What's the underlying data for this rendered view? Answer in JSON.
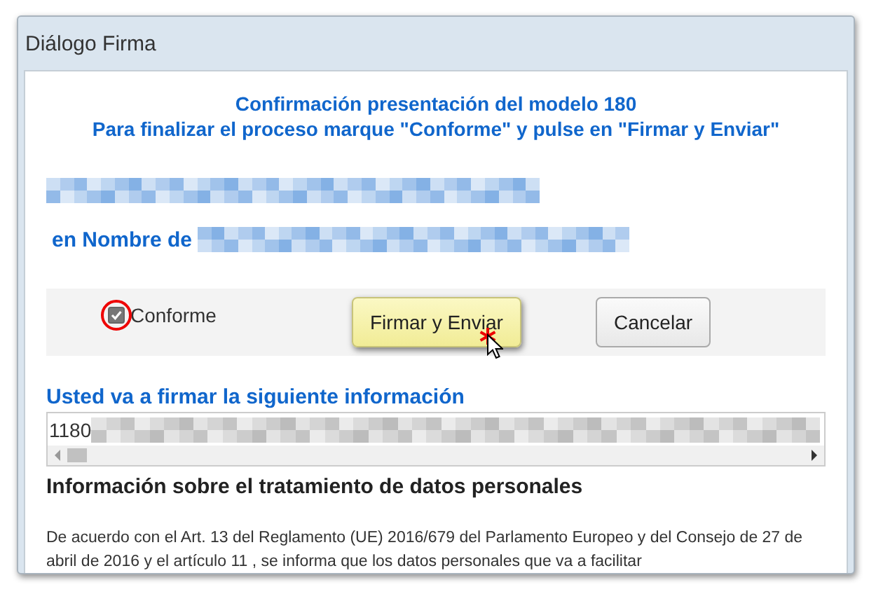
{
  "window": {
    "title": "Diálogo Firma"
  },
  "heading": [
    "Confirmación presentación del modelo 180",
    "Para finalizar el proceso marque \"Conforme\" y pulse en \"Firmar y Enviar\""
  ],
  "signer": {
    "redacted": true
  },
  "on_behalf": {
    "label": "en Nombre de",
    "redacted": true
  },
  "agree": {
    "label": "Conforme",
    "checked": true,
    "highlighted": true
  },
  "buttons": [
    {
      "label": "Firmar y Enviar",
      "kind": "primary",
      "hovered": true
    },
    {
      "label": "Cancelar",
      "kind": "normal",
      "hovered": false
    }
  ],
  "sign_info": {
    "label": "Usted va a firmar la siguiente información",
    "value": "1180",
    "redacted": true
  },
  "privacy": {
    "title": "Información sobre el tratamiento de datos personales",
    "text": "De acuerdo con el Art. 13 del Reglamento (UE) 2016/679 del Parlamento Europeo y del Consejo de 27 de abril de 2016 y el artículo 11 , se informa que los datos personales que va a facilitar"
  }
}
